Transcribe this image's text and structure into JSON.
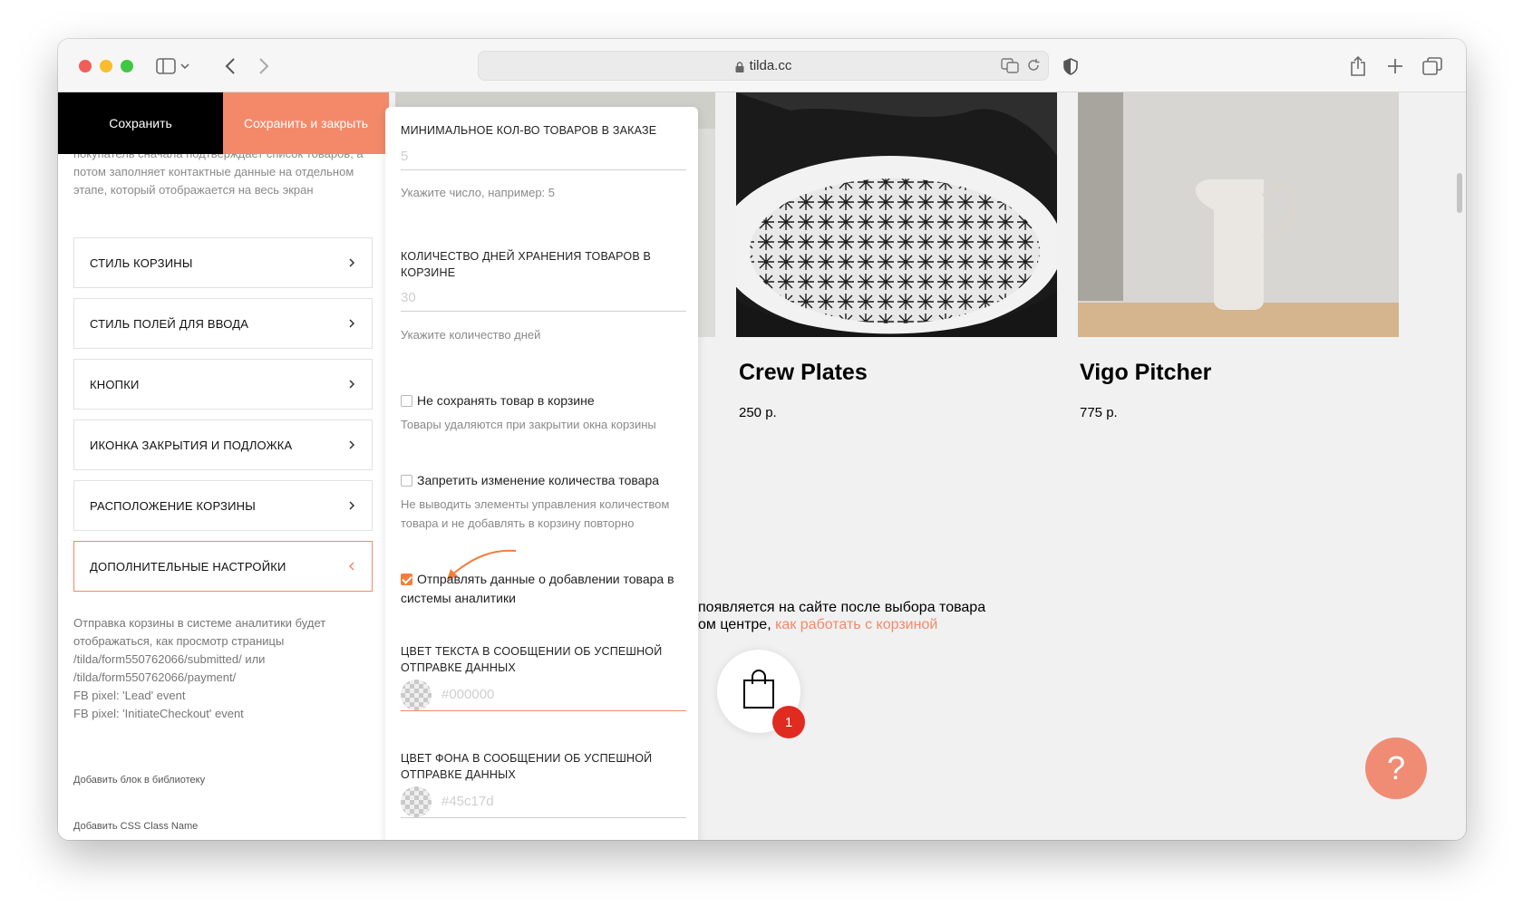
{
  "browser": {
    "url": "tilda.cc"
  },
  "toolbar": {
    "save_label": "Сохранить",
    "save_close_label": "Сохранить и закрыть"
  },
  "left_panel": {
    "intro_text": "покупатель сначала подтверждает список товаров, а потом заполняет контактные данные на отдельном этапе, который отображается на весь экран",
    "sections": [
      {
        "label": "СТИЛЬ КОРЗИНЫ"
      },
      {
        "label": "СТИЛЬ ПОЛЕЙ ДЛЯ ВВОДА"
      },
      {
        "label": "КНОПКИ"
      },
      {
        "label": "ИКОНКА ЗАКРЫТИЯ И ПОДЛОЖКА"
      },
      {
        "label": "РАСПОЛОЖЕНИЕ КОРЗИНЫ"
      },
      {
        "label": "ДОПОЛНИТЕЛЬНЫЕ НАСТРОЙКИ"
      }
    ],
    "analytics_note": [
      "Отправка корзины в системе аналитики будет отображаться, как просмотр страницы",
      "/tilda/form550762066/submitted/ или",
      "/tilda/form550762066/payment/",
      "FB pixel: 'Lead' event",
      "FB pixel: 'InitiateCheckout' event"
    ],
    "add_to_library": "Добавить блок в библиотеку",
    "add_css_class": "Добавить CSS Class Name"
  },
  "form": {
    "min_qty": {
      "title": "МИНИМАЛЬНОЕ КОЛ-ВО ТОВАРОВ В ЗАКАЗЕ",
      "placeholder": "5",
      "hint": "Укажите число, например: 5"
    },
    "storage_days": {
      "title": "КОЛИЧЕСТВО ДНЕЙ ХРАНЕНИЯ ТОВАРОВ В КОРЗИНЕ",
      "placeholder": "30",
      "hint": "Укажите количество дней"
    },
    "no_save": {
      "label": "Не сохранять товар в корзине",
      "hint": "Товары удаляются при закрытии окна корзины",
      "checked": false
    },
    "no_qty_change": {
      "label": "Запретить изменение количества товара",
      "hint": "Не выводить элементы управления количеством товара и не добавлять в корзину повторно",
      "checked": false
    },
    "send_analytics": {
      "label": "Отправлять данные о добавлении товара в системы аналитики",
      "checked": true
    },
    "success_text_color": {
      "title": "ЦВЕТ ТЕКСТА В СООБЩЕНИИ ОБ УСПЕШНОЙ ОТПРАВКЕ ДАННЫХ",
      "placeholder": "#000000"
    },
    "success_bg_color": {
      "title": "ЦВЕТ ФОНА В СООБЩЕНИИ ОБ УСПЕШНОЙ ОТПРАВКЕ ДАННЫХ",
      "placeholder": "#45c17d"
    }
  },
  "store": {
    "products": [
      {
        "name": "Crew Plates",
        "price": "250 р."
      },
      {
        "name": "Vigo Pitcher",
        "price": "775 р."
      }
    ],
    "cart_text_line1": "появляется на сайте после выбора товара",
    "cart_text_line2": "ом центре, ",
    "cart_link": "как работать с корзиной",
    "cart_count": "1",
    "help_icon": "?"
  },
  "colors": {
    "accent": "#f4896a",
    "badge": "#e02b20"
  }
}
